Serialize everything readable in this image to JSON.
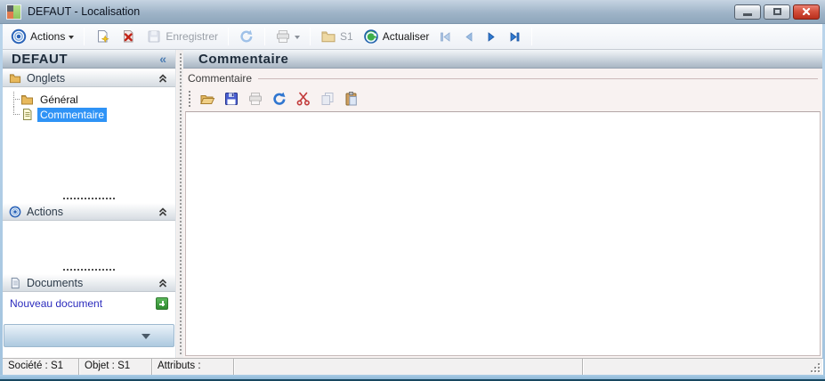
{
  "window": {
    "title": "DEFAUT -  Localisation"
  },
  "toolbar": {
    "actions_label": "Actions",
    "save_label": "Enregistrer",
    "folder_label": "S1",
    "refresh_label": "Actualiser"
  },
  "sidebar": {
    "title": "DEFAUT",
    "collapse_glyph": "«",
    "sections": [
      {
        "label": "Onglets"
      },
      {
        "label": "Actions"
      },
      {
        "label": "Documents"
      }
    ],
    "tree": [
      {
        "label": "Général",
        "icon": "folder-icon",
        "selected": false
      },
      {
        "label": "Commentaire",
        "icon": "document-icon",
        "selected": true
      }
    ],
    "new_document_label": "Nouveau document"
  },
  "main": {
    "title": "Commentaire",
    "group_label": "Commentaire",
    "editor_value": ""
  },
  "statusbar": {
    "panels": [
      "Société : S1",
      "Objet : S1",
      "Attributs :",
      "",
      ""
    ]
  },
  "icons": [
    "app-icon",
    "actions-target-icon",
    "new-document-icon",
    "delete-icon",
    "save-icon",
    "sync-icon",
    "print-icon",
    "folder-icon",
    "refresh-globe-icon",
    "nav-first-icon",
    "nav-prev-icon",
    "nav-next-icon",
    "nav-last-icon",
    "collapse-chevrons-icon",
    "open-folder-icon",
    "floppy-save-icon",
    "cut-scissors-icon",
    "copy-icon",
    "paste-clipboard-icon",
    "plus-icon",
    "down-arrow-icon",
    "resize-grip-icon"
  ],
  "colors": {
    "selection_blue": "#2f93f6",
    "link_blue": "#2b2bbd",
    "plus_green": "#3c9a3c",
    "close_red": "#c93a28",
    "titlebar_blue": "#9fb4c8"
  }
}
